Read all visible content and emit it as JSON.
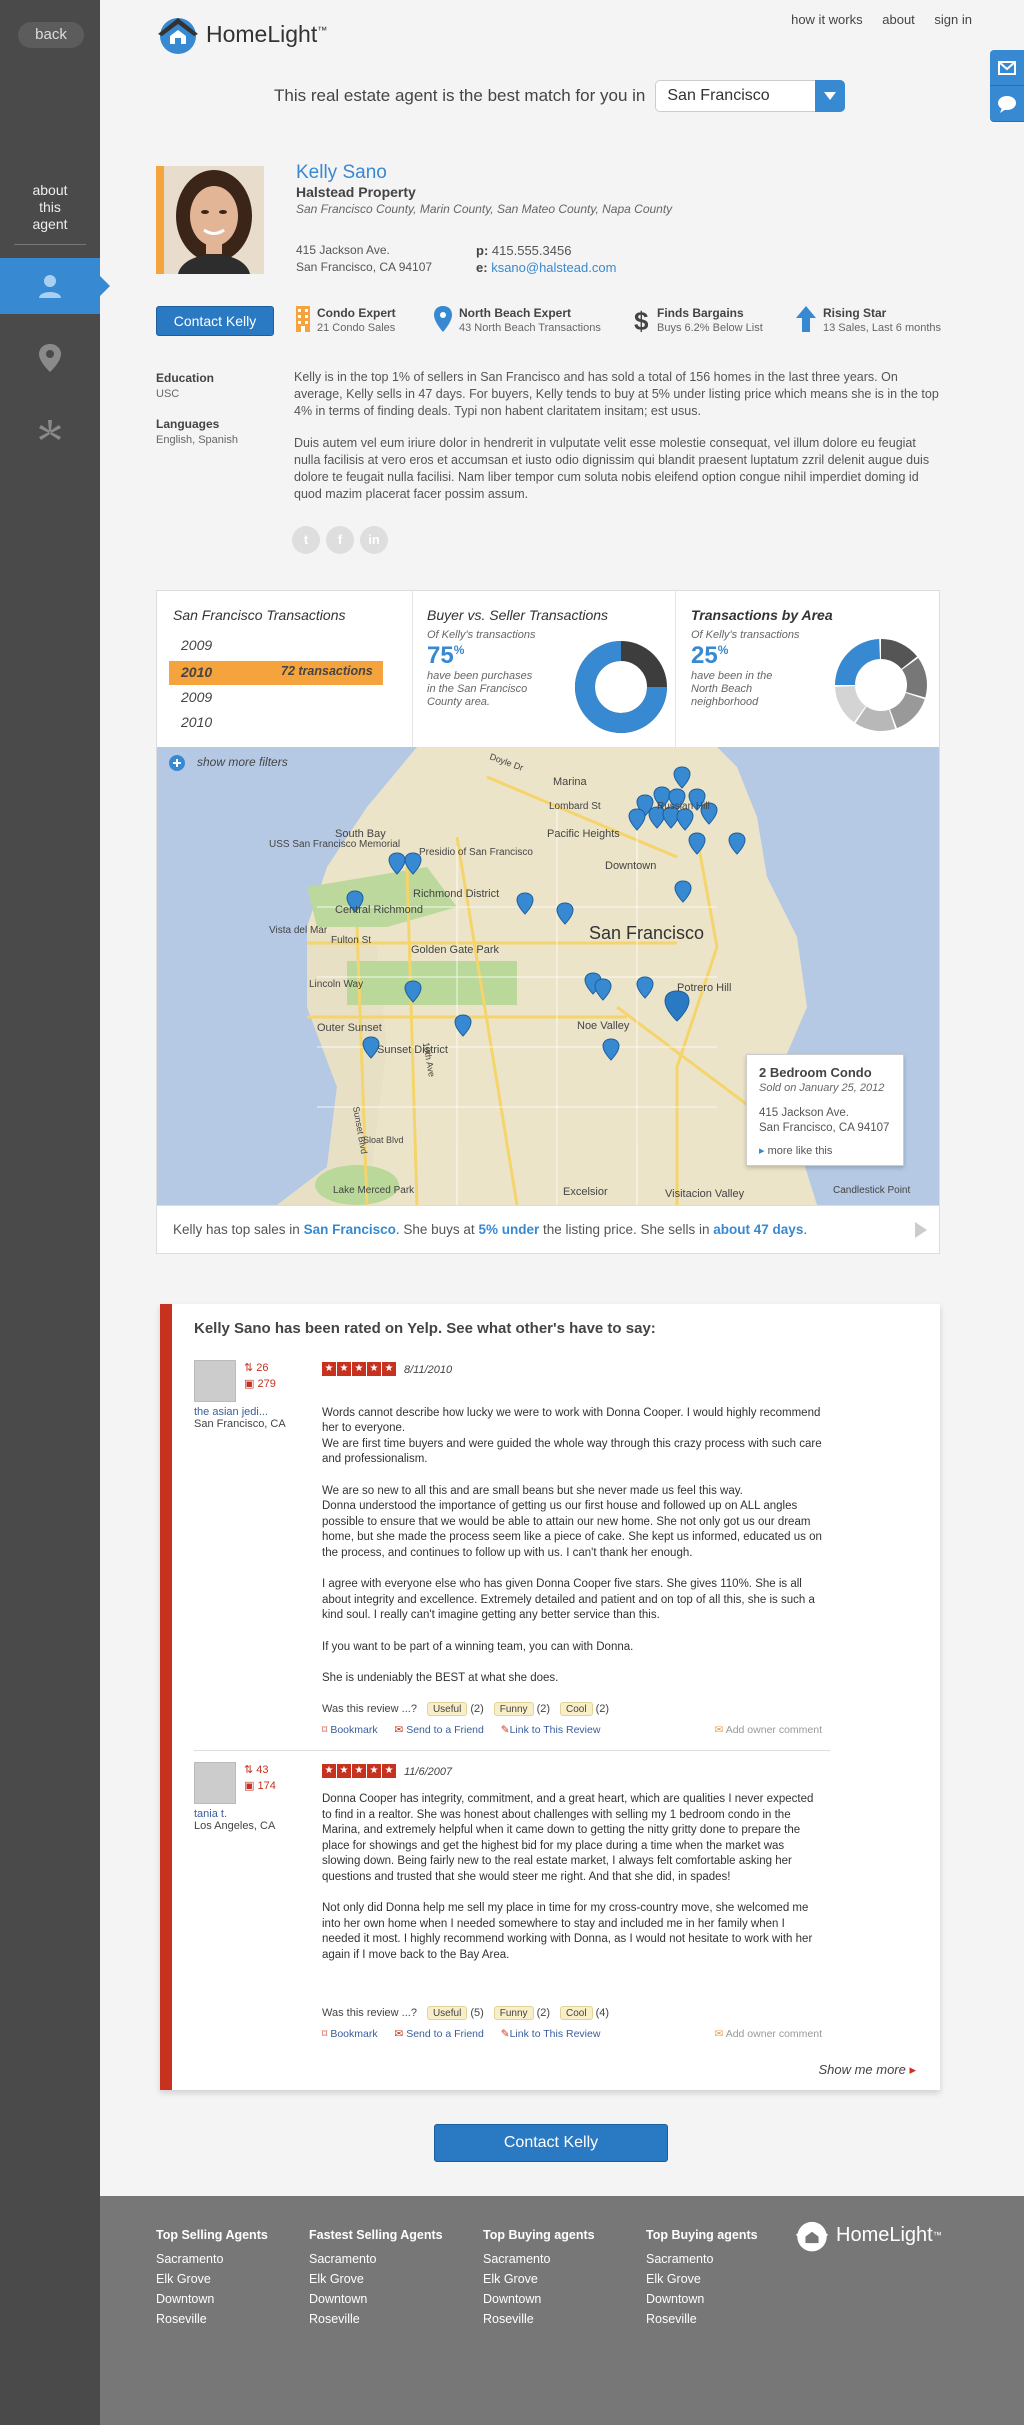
{
  "sidebar": {
    "back_label": "back",
    "about_label": "about\nthis\nagent"
  },
  "header": {
    "logo_text": "HomeLight",
    "logo_tm": "™",
    "nav": [
      "how it works",
      "about",
      "sign in"
    ]
  },
  "match": {
    "text": "This real estate agent is the best match for you in",
    "city": "San Francisco"
  },
  "agent": {
    "name": "Kelly Sano",
    "company": "Halstead Property",
    "areas": "San Francisco County, Marin County, San Mateo County, Napa County",
    "address_line1": "415 Jackson Ave.",
    "address_line2": "San Francisco, CA 94107",
    "phone_label": "p:",
    "phone": "415.555.3456",
    "email_label": "e:",
    "email": "ksano@halstead.com",
    "contact_label": "Contact Kelly"
  },
  "badges": [
    {
      "title": "Condo Expert",
      "sub": "21 Condo Sales",
      "icon": "building-icon",
      "color": "#f5a33c"
    },
    {
      "title": "North Beach Expert",
      "sub": "43 North Beach Transactions",
      "icon": "map-pin-icon",
      "color": "#3789d1"
    },
    {
      "title": "Finds Bargains",
      "sub": "Buys 6.2% Below List",
      "icon": "dollar-icon",
      "color": "#444444"
    },
    {
      "title": "Rising Star",
      "sub": "13 Sales, Last 6 months",
      "icon": "arrow-up-icon",
      "color": "#3789d1"
    }
  ],
  "education": {
    "label": "Education",
    "value": "USC"
  },
  "languages": {
    "label": "Languages",
    "value": "English, Spanish"
  },
  "bio": [
    "Kelly is in the top 1% of sellers in San Francisco and has sold a total of 156 homes in the last three years. On average, Kelly sells in 47 days. For buyers, Kelly tends to buy at 5% under listing price which means she is in the top 4% in terms of finding deals. Typi non habent claritatem insitam; est usus.",
    "Duis autem vel eum iriure dolor in hendrerit in vulputate velit esse molestie consequat, vel illum dolore eu feugiat nulla facilisis at vero eros et accumsan et iusto odio dignissim qui blandit praesent luptatum zzril delenit augue duis dolore te feugait nulla facilisi. Nam liber tempor cum soluta nobis eleifend option congue nihil imperdiet doming id quod mazim placerat facer possim assum."
  ],
  "social": [
    "t",
    "f",
    "in"
  ],
  "transactions": {
    "title": "San Francisco Transactions",
    "years": [
      "2009",
      "2010",
      "2009",
      "2010"
    ],
    "active_count": "72 transactions"
  },
  "buyer_seller": {
    "title": "Buyer vs. Seller Transactions",
    "intro": "Of Kelly's transactions",
    "value": "75",
    "unit": "%",
    "desc": "have been purchases in the San Francisco County area.",
    "fraction": 0.75,
    "color_main": "#3789d1",
    "color_rest": "#3d3d3d"
  },
  "by_area": {
    "title": "Transactions by Area",
    "intro": "Of Kelly's transactions",
    "value": "25",
    "unit": "%",
    "desc": "have been in the North Beach neighborhood",
    "fraction": 0.25
  },
  "map": {
    "filters_label": "show more filters",
    "labels": [
      "Marina",
      "Lombard St",
      "Russian Hill",
      "Pacific Heights",
      "Downtown",
      "USS San Francisco Memorial",
      "South Bay",
      "Presidio of San Francisco",
      "Richmond District",
      "Central Richmond",
      "Vista del Mar",
      "Fulton St",
      "Golden Gate Park",
      "San Francisco",
      "Lincoln Way",
      "Outer Sunset",
      "Sunset District",
      "Potrero Hill",
      "Noe Valley",
      "Lake Merced Park",
      "Excelsior",
      "Visitacion Valley",
      "Candlestick Point",
      "Sunset Blvd",
      "Sloat Blvd",
      "19th Ave",
      "Doyle Dr"
    ],
    "popup": {
      "title": "2 Bedroom Condo",
      "sold": "Sold on January 25, 2012",
      "address1": "415 Jackson Ave.",
      "address2": "San Francisco, CA 94107",
      "more": "more like this"
    },
    "caption_1": "Kelly has top sales in ",
    "caption_city": "San Francisco",
    "caption_2": ". She buys at ",
    "caption_under": "5% under",
    "caption_3": " the listing price. She sells in ",
    "caption_days": "about 47 days",
    "caption_4": "."
  },
  "yelp": {
    "title": "Kelly Sano has been rated on Yelp. See what other's have to say:",
    "reviews": [
      {
        "friends": "26",
        "reviews": "279",
        "name": "the asian jedi...",
        "location": "San Francisco, CA",
        "date": "8/11/2010",
        "paragraphs": [
          "Words cannot describe how lucky we were to work with Donna Cooper. I would highly recommend her to everyone.\nWe are first time buyers and were guided the whole way through this crazy process with such care and professionalism.",
          "We are so new to all this and are small beans but she never made us feel this way.\nDonna understood the importance of getting us our first house and followed up on ALL angles possible to ensure that we would be able to attain our new home. She not only got us our dream home, but she made the process seem like a piece of cake. She kept us informed, educated us on the process, and continues to follow up with us. I can't thank her enough.",
          "I agree with everyone else who has given Donna Cooper five stars. She gives 110%. She is all about integrity and excellence. Extremely detailed and patient and on top of all this, she is such a kind soul. I really can't imagine getting any better service than this.",
          "If you want to be part of a winning team, you can with Donna.",
          "She is undeniably the BEST at what she does."
        ],
        "useful": "(2)",
        "funny": "(2)",
        "cool": "(2)"
      },
      {
        "friends": "43",
        "reviews": "174",
        "name": "tania t.",
        "location": "Los Angeles, CA",
        "date": "11/6/2007",
        "paragraphs": [
          "Donna Cooper has integrity, commitment, and a great heart, which are qualities I never expected to find in a realtor. She was honest about challenges with selling my 1 bedroom condo in the Marina, and extremely helpful when it came down to getting the nitty gritty done to prepare the place for showings and get the highest bid for my place during a time when the market was slowing down. Being fairly new to the real estate market, I always felt comfortable asking her questions and trusted that she would steer me right. And that she did, in spades!",
          "Not only did Donna help me sell my place in time for my cross-country move, she welcomed me into her own home when I needed somewhere to stay and included me in her family when I needed it most. I highly recommend working with Donna, as I would not hesitate to work with her again if I move back to the Bay Area."
        ],
        "useful": "(5)",
        "funny": "(2)",
        "cool": "(4)"
      }
    ],
    "was_review": "Was this review ...?",
    "useful_label": "Useful",
    "funny_label": "Funny",
    "cool_label": "Cool",
    "bookmark": "Bookmark",
    "send": "Send to a Friend",
    "link": "Link to This Review",
    "owner_comment": "Add owner comment",
    "show_more": "Show me more"
  },
  "contact_bottom": "Contact Kelly",
  "footer": {
    "columns": [
      {
        "title": "Top Selling Agents",
        "items": [
          "Sacramento",
          "Elk Grove",
          "Downtown",
          "Roseville"
        ]
      },
      {
        "title": "Fastest Selling Agents",
        "items": [
          "Sacramento",
          "Elk Grove",
          "Downtown",
          "Roseville"
        ]
      },
      {
        "title": "Top Buying agents",
        "items": [
          "Sacramento",
          "Elk Grove",
          "Downtown",
          "Roseville"
        ]
      },
      {
        "title": "Top Buying agents",
        "items": [
          "Sacramento",
          "Elk Grove",
          "Downtown",
          "Roseville"
        ]
      }
    ],
    "logo_text": "HomeLight",
    "logo_tm": "™"
  }
}
